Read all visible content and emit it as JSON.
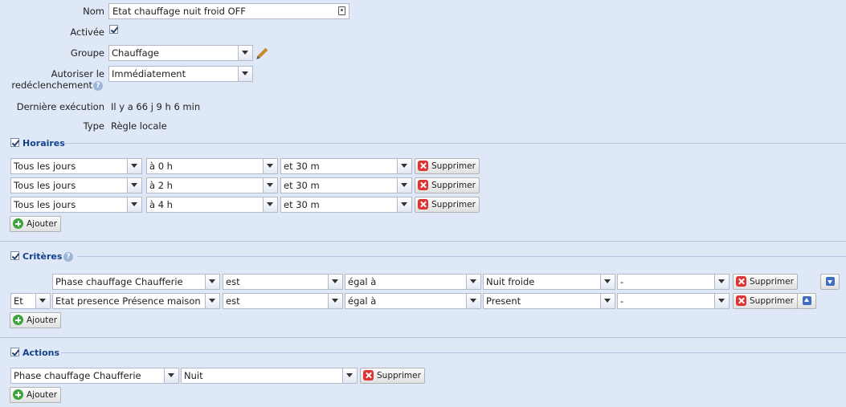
{
  "general": {
    "nom_label": "Nom",
    "nom_value": "Etat chauffage nuit froid OFF",
    "activee_label": "Activée",
    "groupe_label": "Groupe",
    "groupe_value": "Chauffage",
    "autoriser_label_1": "Autoriser le",
    "autoriser_label_2": "redéclenchement",
    "autoriser_value": "Immédiatement",
    "derniere_label": "Dernière exécution",
    "derniere_value": "Il y a 66 j 9 h 6 min",
    "type_label": "Type",
    "type_value": "Règle locale"
  },
  "horaires": {
    "title": "Horaires",
    "rows": [
      {
        "jour": "Tous les jours",
        "heure": "à 0 h",
        "minute": "et 30 m",
        "delete": "Supprimer"
      },
      {
        "jour": "Tous les jours",
        "heure": "à 2 h",
        "minute": "et 30 m",
        "delete": "Supprimer"
      },
      {
        "jour": "Tous les jours",
        "heure": "à 4 h",
        "minute": "et 30 m",
        "delete": "Supprimer"
      }
    ],
    "add": "Ajouter"
  },
  "criteres": {
    "title": "Critères",
    "rows": [
      {
        "connector": "",
        "device": "Phase chauffage Chaufferie",
        "op1": "est",
        "op2": "égal à",
        "value": "Nuit froide",
        "extra": "-",
        "delete": "Supprimer"
      },
      {
        "connector": "Et",
        "device": "Etat presence Présence maison",
        "op1": "est",
        "op2": "égal à",
        "value": "Present",
        "extra": "-",
        "delete": "Supprimer"
      }
    ],
    "add": "Ajouter"
  },
  "actions": {
    "title": "Actions",
    "rows": [
      {
        "device": "Phase chauffage Chaufferie",
        "value": "Nuit",
        "delete": "Supprimer"
      }
    ],
    "add": "Ajouter"
  },
  "icons": {
    "help": "help-icon",
    "delete": "delete-icon",
    "add": "add-icon",
    "edit": "pencil-icon",
    "move_down": "arrow-down-icon",
    "move_up": "arrow-up-icon"
  }
}
